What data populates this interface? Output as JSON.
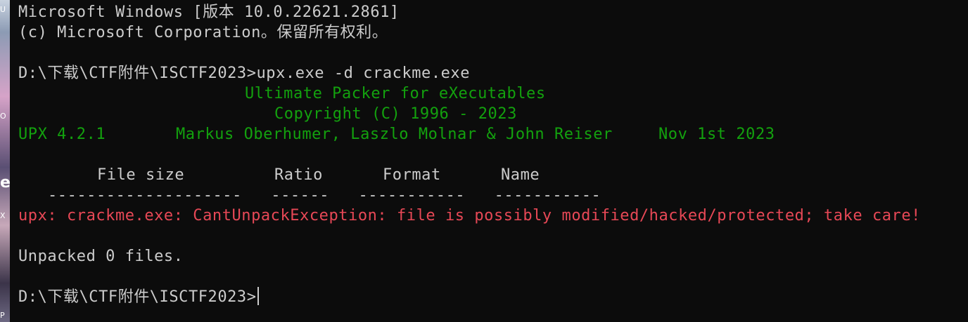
{
  "terminal": {
    "header_line1": "Microsoft Windows [版本 10.0.22621.2861]",
    "header_line2": "(c) Microsoft Corporation。保留所有权利。",
    "prompt": "D:\\下载\\CTF附件\\ISCTF2023>",
    "command": "upx.exe -d crackme.exe",
    "upx_title": "Ultimate Packer for eXecutables",
    "upx_copyright": "Copyright (C) 1996 - 2023",
    "upx_version": "UPX 4.2.1",
    "upx_authors": "Markus Oberhumer, Laszlo Molnar & John Reiser",
    "upx_date": "Nov 1st 2023",
    "table_headers": [
      "File size",
      "Ratio",
      "Format",
      "Name"
    ],
    "table_rule": "--------------------   ------   -----------   -----------",
    "error": "upx: crackme.exe: CantUnpackException: file is possibly modified/hacked/protected; take care!",
    "summary": "Unpacked 0 files.",
    "final_prompt": "D:\\下载\\CTF附件\\ISCTF2023>"
  },
  "colors": {
    "background": "#0c0c0c",
    "text": "#cccccc",
    "green": "#13a10e",
    "red": "#e74856"
  }
}
